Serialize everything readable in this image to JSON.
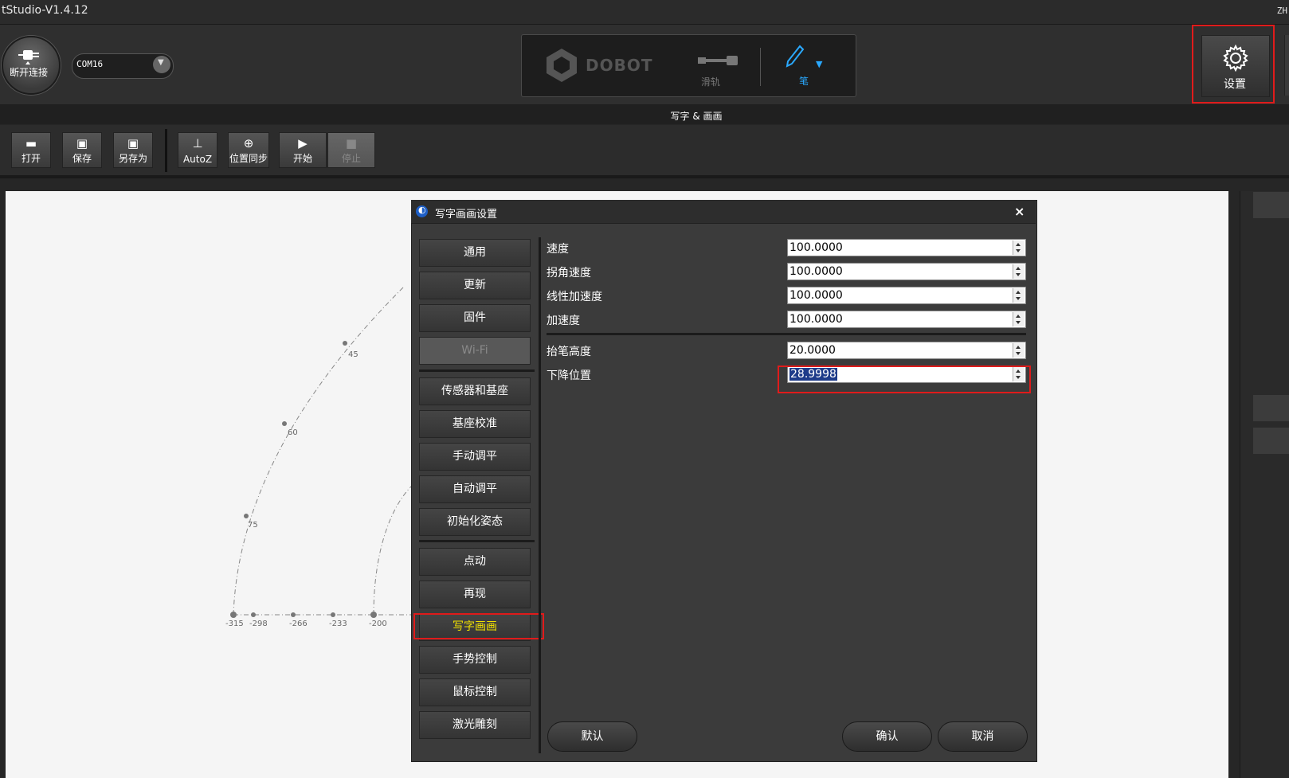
{
  "app": {
    "title": "tStudio-V1.4.12",
    "lang": "ZH"
  },
  "topbar": {
    "connect_label": "断开连接",
    "port_value": "COM16",
    "device_logo": "DOBOT",
    "rail_label": "滑轨",
    "pen_label": "笔",
    "settings_label": "设置"
  },
  "section": {
    "label": "写字 & 画画"
  },
  "toolbar": {
    "open": "打开",
    "save": "保存",
    "save_as": "另存为",
    "autoz": "AutoZ",
    "sync": "位置同步",
    "start": "开始",
    "stop": "停止"
  },
  "canvas": {
    "angle_labels": [
      "45",
      "60",
      "75"
    ],
    "x_labels": [
      "-315",
      "-298",
      "-266",
      "-233",
      "-200"
    ]
  },
  "dialog": {
    "title": "写字画画设置",
    "close": "×",
    "nav": [
      "通用",
      "更新",
      "固件",
      "Wi-Fi",
      "传感器和基座",
      "基座校准",
      "手动调平",
      "自动调平",
      "初始化姿态",
      "点动",
      "再现",
      "写字画画",
      "手势控制",
      "鼠标控制",
      "激光雕刻"
    ],
    "fields": [
      {
        "label": "速度",
        "value": "100.0000"
      },
      {
        "label": "拐角速度",
        "value": "100.0000"
      },
      {
        "label": "线性加速度",
        "value": "100.0000"
      },
      {
        "label": "加速度",
        "value": "100.0000"
      },
      {
        "label": "抬笔高度",
        "value": "20.0000"
      },
      {
        "label": "下降位置",
        "value": "28.9998"
      }
    ],
    "buttons": {
      "default": "默认",
      "confirm": "确认",
      "cancel": "取消"
    }
  },
  "colors": {
    "highlight": "#e01b1b",
    "active_nav": "#f2e200",
    "selection": "#1e3c8a",
    "pen_accent": "#2aa9ff"
  }
}
